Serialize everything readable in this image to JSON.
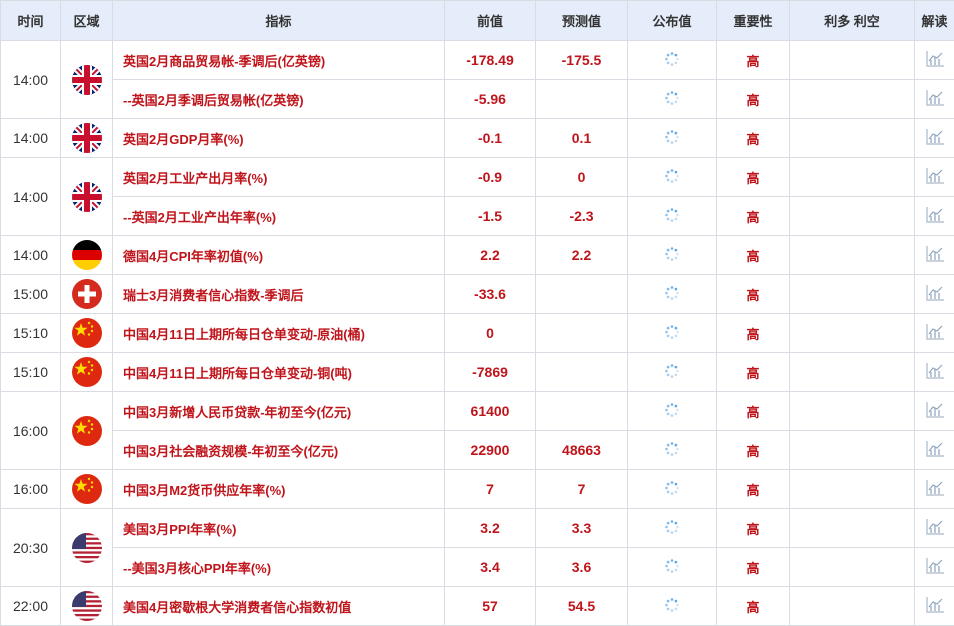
{
  "headers": {
    "time": "时间",
    "region": "区域",
    "indicator": "指标",
    "previous": "前值",
    "forecast": "预测值",
    "actual": "公布值",
    "importance": "重要性",
    "impact": "利多 利空",
    "analysis": "解读"
  },
  "colors": {
    "accent_red": "#c0141b",
    "header_bg": "#e4edf9",
    "border": "#d9dde3"
  },
  "groups": [
    {
      "time": "14:00",
      "flag": "uk",
      "rows": [
        {
          "name": "英国2月商品贸易帐-季调后(亿英镑)",
          "previous": "-178.49",
          "forecast": "-175.5",
          "importance": "高"
        },
        {
          "name": "--英国2月季调后贸易帐(亿英镑)",
          "previous": "-5.96",
          "forecast": "",
          "importance": "高"
        }
      ]
    },
    {
      "time": "14:00",
      "flag": "uk",
      "rows": [
        {
          "name": "英国2月GDP月率(%)",
          "previous": "-0.1",
          "forecast": "0.1",
          "importance": "高"
        }
      ]
    },
    {
      "time": "14:00",
      "flag": "uk",
      "rows": [
        {
          "name": "英国2月工业产出月率(%)",
          "previous": "-0.9",
          "forecast": "0",
          "importance": "高"
        },
        {
          "name": "--英国2月工业产出年率(%)",
          "previous": "-1.5",
          "forecast": "-2.3",
          "importance": "高"
        }
      ]
    },
    {
      "time": "14:00",
      "flag": "de",
      "rows": [
        {
          "name": "德国4月CPI年率初值(%)",
          "previous": "2.2",
          "forecast": "2.2",
          "importance": "高"
        }
      ]
    },
    {
      "time": "15:00",
      "flag": "ch",
      "rows": [
        {
          "name": "瑞士3月消费者信心指数-季调后",
          "previous": "-33.6",
          "forecast": "",
          "importance": "高"
        }
      ]
    },
    {
      "time": "15:10",
      "flag": "cn",
      "rows": [
        {
          "name": "中国4月11日上期所每日仓单变动-原油(桶)",
          "previous": "0",
          "forecast": "",
          "importance": "高"
        }
      ]
    },
    {
      "time": "15:10",
      "flag": "cn",
      "rows": [
        {
          "name": "中国4月11日上期所每日仓单变动-铜(吨)",
          "previous": "-7869",
          "forecast": "",
          "importance": "高"
        }
      ]
    },
    {
      "time": "16:00",
      "flag": "cn",
      "rows": [
        {
          "name": "中国3月新增人民币贷款-年初至今(亿元)",
          "previous": "61400",
          "forecast": "",
          "importance": "高"
        },
        {
          "name": "中国3月社会融资规模-年初至今(亿元)",
          "previous": "22900",
          "forecast": "48663",
          "importance": "高"
        }
      ]
    },
    {
      "time": "16:00",
      "flag": "cn",
      "rows": [
        {
          "name": "中国3月M2货币供应年率(%)",
          "previous": "7",
          "forecast": "7",
          "importance": "高"
        }
      ]
    },
    {
      "time": "20:30",
      "flag": "us",
      "rows": [
        {
          "name": "美国3月PPI年率(%)",
          "previous": "3.2",
          "forecast": "3.3",
          "importance": "高"
        },
        {
          "name": "--美国3月核心PPI年率(%)",
          "previous": "3.4",
          "forecast": "3.6",
          "importance": "高"
        }
      ]
    },
    {
      "time": "22:00",
      "flag": "us",
      "rows": [
        {
          "name": "美国4月密歇根大学消费者信心指数初值",
          "previous": "57",
          "forecast": "54.5",
          "importance": "高"
        }
      ]
    }
  ]
}
